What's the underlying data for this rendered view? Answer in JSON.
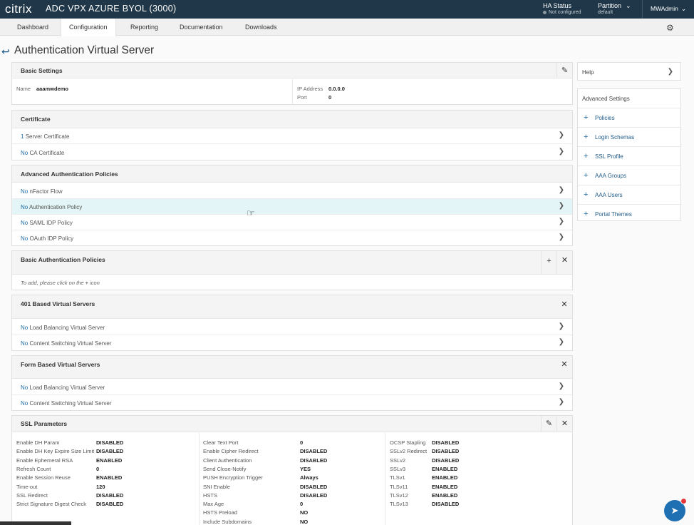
{
  "header": {
    "logo": "citrix",
    "title": "ADC VPX AZURE BYOL (3000)",
    "ha_status_label": "HA Status",
    "ha_status_value": "Not configured",
    "partition_label": "Partition",
    "partition_value": "default",
    "user": "MWAdmin"
  },
  "nav": {
    "tabs": [
      {
        "label": "Dashboard"
      },
      {
        "label": "Configuration"
      },
      {
        "label": "Reporting"
      },
      {
        "label": "Documentation"
      },
      {
        "label": "Downloads"
      }
    ],
    "active": "Configuration"
  },
  "page": {
    "title": "Authentication Virtual Server"
  },
  "basic_settings": {
    "title": "Basic Settings",
    "name_label": "Name",
    "name_value": "aaamwdemo",
    "ip_label": "IP Address",
    "ip_value": "0.0.0.0",
    "port_label": "Port",
    "port_value": "0"
  },
  "certificate": {
    "title": "Certificate",
    "rows": [
      {
        "count": "1",
        "label": "Server Certificate"
      },
      {
        "count": "No",
        "label": "CA Certificate"
      }
    ]
  },
  "adv_auth": {
    "title": "Advanced Authentication Policies",
    "rows": [
      {
        "count": "No",
        "label": "nFactor Flow"
      },
      {
        "count": "No",
        "label": "Authentication Policy"
      },
      {
        "count": "No",
        "label": "SAML IDP Policy"
      },
      {
        "count": "No",
        "label": "OAuth IDP Policy"
      }
    ]
  },
  "basic_auth": {
    "title": "Basic Authentication Policies",
    "hint_before": "To add, please click on the",
    "hint_after": "icon"
  },
  "vs401": {
    "title": "401 Based Virtual Servers",
    "rows": [
      {
        "count": "No",
        "label": "Load Balancing Virtual Server"
      },
      {
        "count": "No",
        "label": "Content Switching Virtual Server"
      }
    ]
  },
  "form_vs": {
    "title": "Form Based Virtual Servers",
    "rows": [
      {
        "count": "No",
        "label": "Load Balancing Virtual Server"
      },
      {
        "count": "No",
        "label": "Content Switching Virtual Server"
      }
    ]
  },
  "ssl": {
    "title": "SSL Parameters",
    "col1": [
      {
        "k": "Enable DH Param",
        "v": "DISABLED"
      },
      {
        "k": "Enable DH Key Expire Size Limit",
        "v": "DISABLED"
      },
      {
        "k": "Enable Ephemeral RSA",
        "v": "ENABLED"
      },
      {
        "k": "Refresh Count",
        "v": "0"
      },
      {
        "k": "Enable Session Reuse",
        "v": "ENABLED"
      },
      {
        "k": "Time-out",
        "v": "120"
      },
      {
        "k": "SSL Redirect",
        "v": "DISABLED"
      },
      {
        "k": "Strict Signature Digest Check",
        "v": "DISABLED"
      }
    ],
    "col2": [
      {
        "k": "Clear Text Port",
        "v": "0"
      },
      {
        "k": "Enable Cipher Redirect",
        "v": "DISABLED"
      },
      {
        "k": "Client Authentication",
        "v": "DISABLED"
      },
      {
        "k": "Send Close-Notify",
        "v": "YES"
      },
      {
        "k": "PUSH Encryption Trigger",
        "v": "Always"
      },
      {
        "k": "SNI Enable",
        "v": "DISABLED"
      },
      {
        "k": "HSTS",
        "v": "DISABLED"
      },
      {
        "k": "Max Age",
        "v": "0"
      },
      {
        "k": "HSTS Preload",
        "v": "NO"
      },
      {
        "k": "Include Subdomains",
        "v": "NO"
      }
    ],
    "col3": [
      {
        "k": "OCSP Stapling",
        "v": "DISABLED"
      },
      {
        "k": "SSLv2 Redirect",
        "v": "DISABLED"
      },
      {
        "k": "SSLv2",
        "v": "DISABLED"
      },
      {
        "k": "SSLv3",
        "v": "ENABLED"
      },
      {
        "k": "TLSv1",
        "v": "ENABLED"
      },
      {
        "k": "TLSv11",
        "v": "ENABLED"
      },
      {
        "k": "TLSv12",
        "v": "ENABLED"
      },
      {
        "k": "TLSv13",
        "v": "DISABLED"
      }
    ]
  },
  "sidebar": {
    "help": "Help",
    "advanced_title": "Advanced Settings",
    "items": [
      {
        "label": "Policies"
      },
      {
        "label": "Login Schemas"
      },
      {
        "label": "SSL Profile"
      },
      {
        "label": "AAA Groups"
      },
      {
        "label": "AAA Users"
      },
      {
        "label": "Portal Themes"
      }
    ]
  },
  "icons": {
    "back": "back-arrow-icon",
    "edit": "pencil-icon",
    "close": "close-icon",
    "add": "plus-icon",
    "chevron": "chevron-right-icon",
    "settings": "gear-icon",
    "assist": "navigation-icon"
  },
  "colors": {
    "header_bg": "#1f3748",
    "link": "#1e6aa3",
    "highlight_row": "#e3f5f6",
    "fab": "#1f6fb3"
  }
}
